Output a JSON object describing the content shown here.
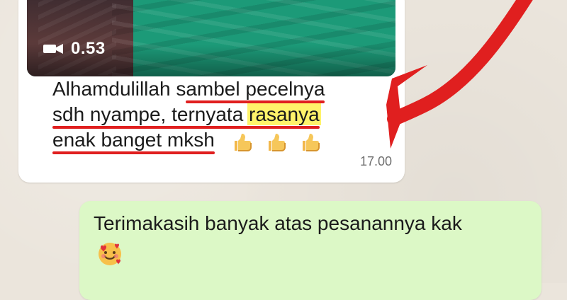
{
  "incoming": {
    "video": {
      "duration": "0.53"
    },
    "text": {
      "line1_prefix": "Alhamdulillah s",
      "line1_underlined": "ambel pecelnya",
      "line2_underlined_1": "sdh nyampe, ternyata ",
      "line2_highlight": "rasanya",
      "line3_underlined": "enak banget mksh"
    },
    "time": "17.00",
    "emoji": [
      "thumbs-up",
      "thumbs-up",
      "thumbs-up"
    ]
  },
  "outgoing": {
    "text": "Terimakasih banyak atas pesanannya kak",
    "emoji": "smiling-face-with-hearts"
  },
  "colors": {
    "incoming_bubble": "#ffffff",
    "outgoing_bubble": "#dcf8c6",
    "annotation_red": "#e01f1f",
    "highlight_yellow": "#fff36a",
    "video_green": "#1c9a78"
  },
  "icons": {
    "video_badge": "video-camera-icon"
  }
}
